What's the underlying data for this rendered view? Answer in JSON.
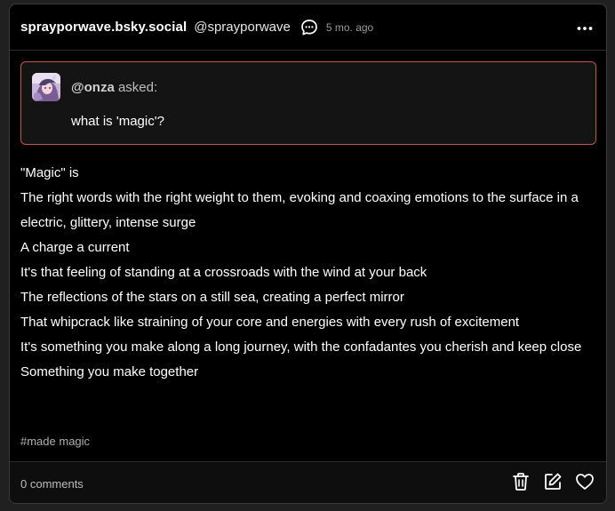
{
  "post": {
    "blog_name": "sprayporwave.bsky.social",
    "handle": "@sprayporwave",
    "time_ago": "5 mo. ago",
    "icons": {
      "chat": "chat-bubble-icon",
      "more": "more-horizontal-icon"
    }
  },
  "ask": {
    "asker": "@onza",
    "asked_label": "asked:",
    "question": "what is 'magic'?",
    "accent_color": "#c9524e"
  },
  "body": {
    "lines": [
      "\"Magic\" is",
      "The right words with the right weight to them, evoking and coaxing emotions to the surface in a electric, glittery, intense surge",
      "A charge a current",
      "It's that feeling of standing at a crossroads with the wind at your back",
      "The reflections of the stars on a still sea, creating a perfect mirror",
      "That whipcrack like straining of your core and energies with every rush of excitement",
      "It's something you make along a long journey, with the confadantes you cherish and keep close",
      "Something you make together"
    ]
  },
  "tags": {
    "items": [
      "#made magic"
    ]
  },
  "footer": {
    "comments_label": "0 comments",
    "icons": {
      "delete": "trash-icon",
      "edit": "edit-icon",
      "like": "heart-icon"
    }
  }
}
